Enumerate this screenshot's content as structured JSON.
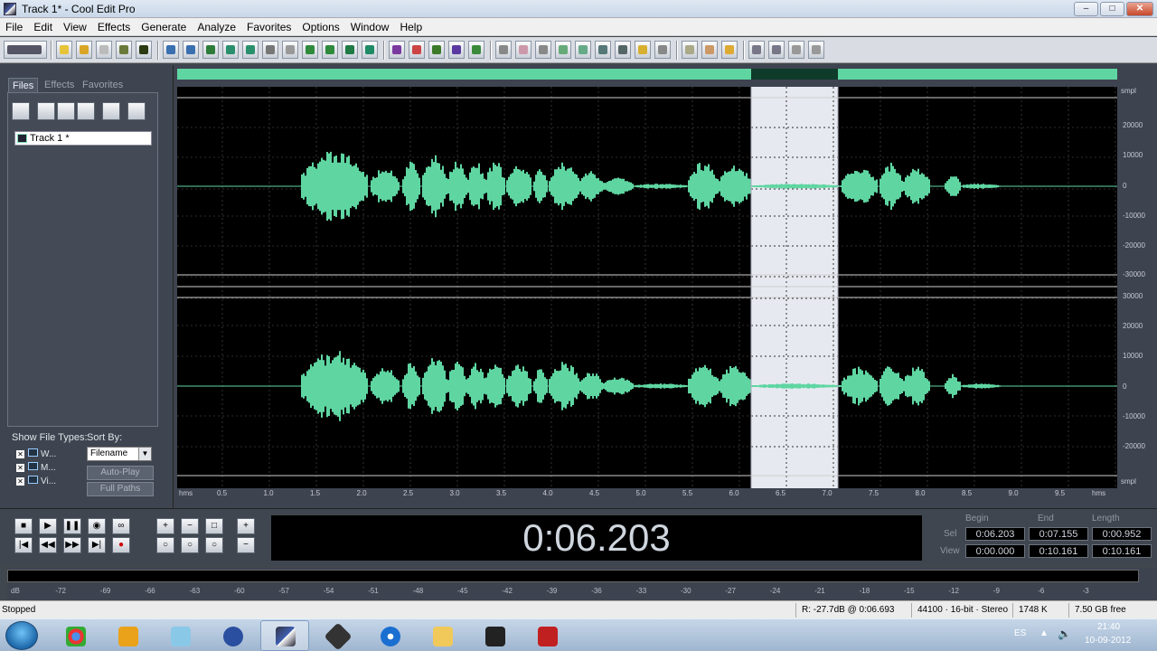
{
  "window": {
    "title": "Track 1* - Cool Edit Pro"
  },
  "menu": [
    "File",
    "Edit",
    "View",
    "Effects",
    "Generate",
    "Analyze",
    "Favorites",
    "Options",
    "Window",
    "Help"
  ],
  "left_panel": {
    "tabs": [
      "Files",
      "Effects",
      "Favorites"
    ],
    "file_item": "Track 1 *",
    "show_file_types_label": "Show File Types:",
    "sort_by_label": "Sort By:",
    "file_types": [
      "W...",
      "M...",
      "Vi..."
    ],
    "sort_value": "Filename",
    "auto_play": "Auto-Play",
    "full_paths": "Full Paths"
  },
  "amplitude_axis": {
    "unit": "smpl",
    "top_labels": [
      "20000",
      "10000",
      "0",
      "-10000",
      "-20000",
      "-30000"
    ],
    "bottom_labels": [
      "30000",
      "20000",
      "10000",
      "0",
      "-10000",
      "-20000"
    ]
  },
  "time_axis": {
    "start": "hms",
    "end": "hms",
    "labels": [
      "0.5",
      "1.0",
      "1.5",
      "2.0",
      "2.5",
      "3.0",
      "3.5",
      "4.0",
      "4.5",
      "5.0",
      "5.5",
      "6.0",
      "6.5",
      "7.0",
      "7.5",
      "8.0",
      "8.5",
      "9.0",
      "9.5"
    ]
  },
  "transport": {
    "time_display": "0:06.203"
  },
  "selection": {
    "headers": [
      "Begin",
      "End",
      "Length"
    ],
    "row_sel_label": "Sel",
    "row_view_label": "View",
    "sel": [
      "0:06.203",
      "0:07.155",
      "0:00.952"
    ],
    "view": [
      "0:00.000",
      "0:10.161",
      "0:10.161"
    ]
  },
  "level_meter": {
    "labels": [
      "dB",
      "-72",
      "-69",
      "-66",
      "-63",
      "-60",
      "-57",
      "-54",
      "-51",
      "-48",
      "-45",
      "-42",
      "-39",
      "-36",
      "-33",
      "-30",
      "-27",
      "-24",
      "-21",
      "-18",
      "-15",
      "-12",
      "-9",
      "-6",
      "-3"
    ]
  },
  "status": {
    "state": "Stopped",
    "cursor": "R: -27.7dB @  0:06.693",
    "format": "44100 · 16-bit · Stereo",
    "size": "1748 K",
    "free": "7.50 GB free"
  },
  "taskbar": {
    "lang": "ES",
    "time": "21:40",
    "date": "10-09-2012"
  }
}
